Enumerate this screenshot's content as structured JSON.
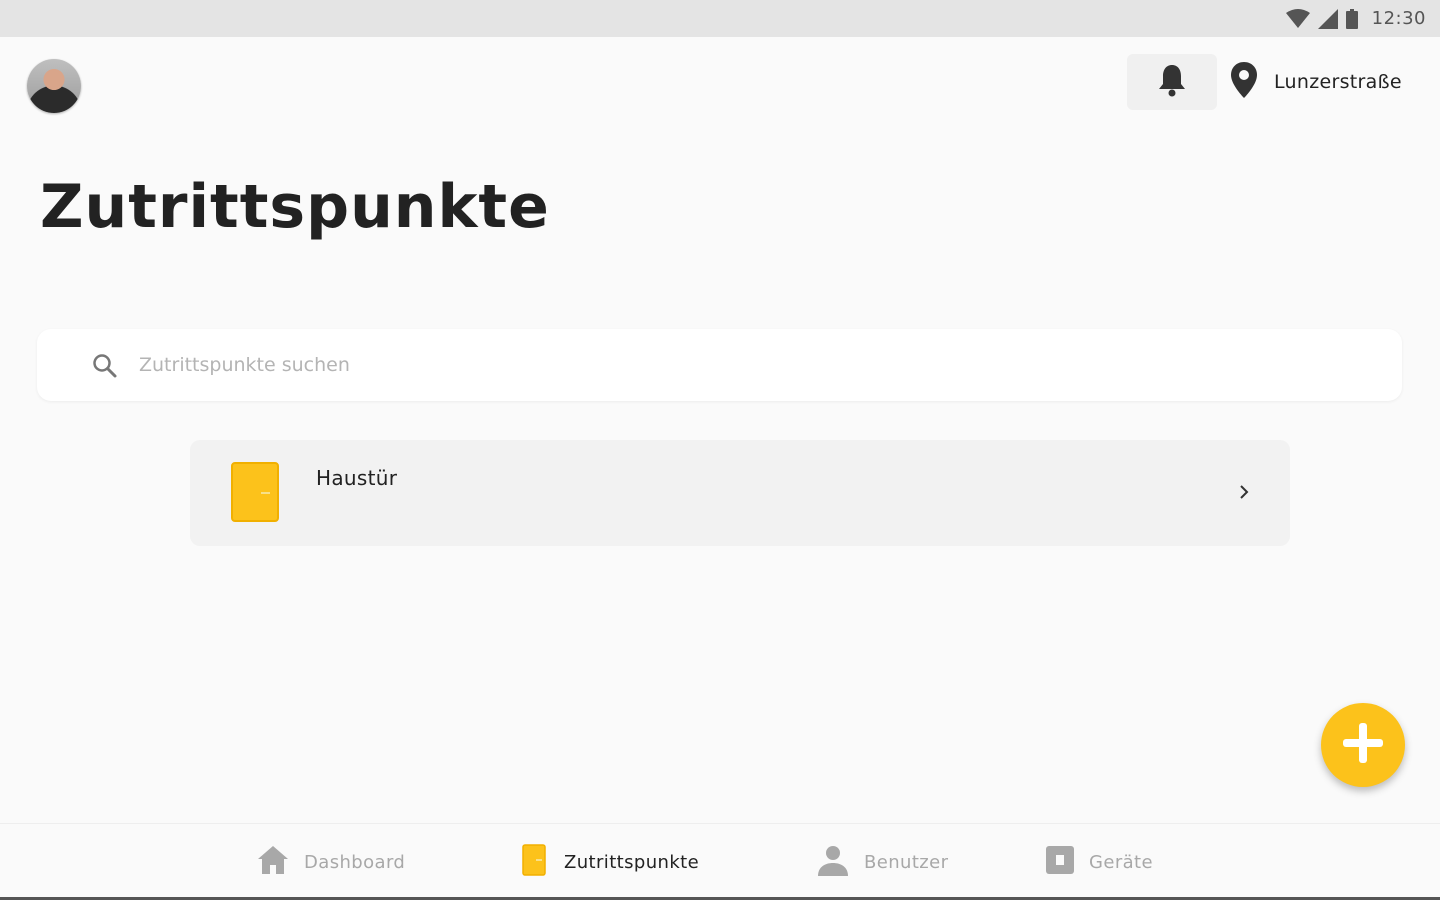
{
  "status_bar": {
    "time": "12:30",
    "icons": [
      "wifi-icon",
      "signal-icon",
      "battery-icon"
    ]
  },
  "header": {
    "avatar_alt": "",
    "location": "Lunzerstraße"
  },
  "page": {
    "title": "Zutrittspunkte"
  },
  "search": {
    "placeholder": "Zutrittspunkte suchen",
    "value": ""
  },
  "access_points": [
    {
      "name": "Haustür",
      "icon": "door-icon"
    }
  ],
  "bottom_nav": [
    {
      "label": "Dashboard",
      "icon": "home-icon",
      "active": false
    },
    {
      "label": "Zutrittspunkte",
      "icon": "door-icon",
      "active": true
    },
    {
      "label": "Benutzer",
      "icon": "person-icon",
      "active": false
    },
    {
      "label": "Geräte",
      "icon": "device-icon",
      "active": false
    }
  ],
  "colors": {
    "accent": "#fcc21b",
    "background": "#fafafa",
    "inactive": "#a8a8a8"
  }
}
